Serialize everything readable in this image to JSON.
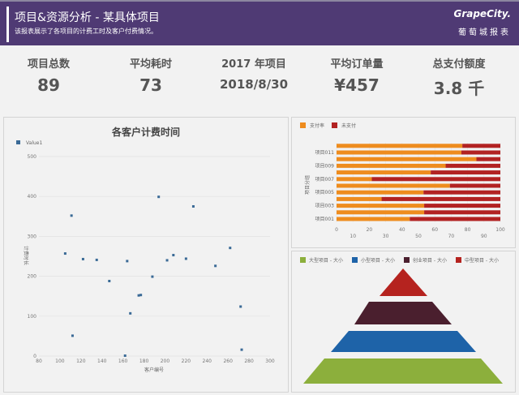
{
  "header": {
    "title": "项目&资源分析 - 某具体项目",
    "subtitle": "该报表展示了各项目的计费工时及客户付费情况。",
    "logo": "GrapeCity.",
    "logo_sub": "葡萄城报表"
  },
  "kpis": [
    {
      "label": "项目总数",
      "value": "89"
    },
    {
      "label": "平均耗时",
      "value": "73"
    },
    {
      "label": "2017 年项目",
      "value": "2018/8/30"
    },
    {
      "label": "平均订单量",
      "value": "¥457"
    },
    {
      "label": "总支付额度",
      "value": "3.8 千"
    }
  ],
  "colors": {
    "header": "#4f3a74",
    "scatter": "#3a6a96",
    "paid": "#ee8c1e",
    "unpaid": "#b22222"
  },
  "chart_data": [
    {
      "type": "scatter",
      "title": "各客户计费时间",
      "xlabel": "客户编号",
      "ylabel": "计费时长",
      "legend": [
        "Value1"
      ],
      "legend_position": "top-left",
      "xlim": [
        80,
        300
      ],
      "ylim": [
        0,
        500
      ],
      "xticks": [
        "80",
        "100",
        "120",
        "140",
        "160",
        "180",
        "200",
        "220",
        "240",
        "260",
        "280",
        "300"
      ],
      "yticks": [
        "0",
        "100",
        "200",
        "300",
        "400",
        "500"
      ],
      "grid": true,
      "series": [
        {
          "name": "Value1",
          "points": [
            [
              105,
              257
            ],
            [
              111,
              352
            ],
            [
              112,
              51
            ],
            [
              122,
              243
            ],
            [
              135,
              241
            ],
            [
              147,
              188
            ],
            [
              162,
              1
            ],
            [
              164,
              238
            ],
            [
              167,
              107
            ],
            [
              175,
              152
            ],
            [
              177,
              153
            ],
            [
              188,
              199
            ],
            [
              194,
              399
            ],
            [
              202,
              240
            ],
            [
              208,
              253
            ],
            [
              220,
              244
            ],
            [
              227,
              375
            ],
            [
              248,
              226
            ],
            [
              262,
              271
            ],
            [
              272,
              124
            ],
            [
              273,
              16
            ]
          ]
        }
      ]
    },
    {
      "type": "bar",
      "orientation": "horizontal",
      "stacked": true,
      "ylabel": "项目分组",
      "legend": [
        "支付率",
        "未支付"
      ],
      "legend_position": "top-left",
      "xlim": [
        0,
        100
      ],
      "xticks": [
        "0",
        "10",
        "20",
        "30",
        "40",
        "50",
        "60",
        "70",
        "80",
        "90",
        "100"
      ],
      "categories": [
        "项目001",
        "项目002",
        "项目003",
        "项目004",
        "项目005",
        "项目006",
        "项目007",
        "项目008",
        "项目009",
        "项目010",
        "项目011",
        "项目012"
      ],
      "category_labels_shown": [
        "项目001",
        "项目003",
        "项目005",
        "项目007",
        "项目009",
        "项目011"
      ],
      "series": [
        {
          "name": "支付率",
          "values": [
            44.7,
            53.5,
            53.5,
            27.5,
            53.1,
            69.2,
            21.5,
            57.5,
            66.6,
            85.4,
            76.2,
            76.8
          ]
        },
        {
          "name": "未支付",
          "values": [
            55.3,
            46.5,
            46.5,
            72.5,
            46.9,
            30.8,
            78.5,
            42.5,
            33.4,
            14.6,
            23.8,
            23.2
          ]
        }
      ]
    },
    {
      "type": "pyramid",
      "legend": [
        "大型项目 - 大小",
        "小型项目 - 大小",
        "创业项目 - 大小",
        "中型项目 - 大小"
      ],
      "legend_position": "top",
      "levels": [
        {
          "name": "中型项目 - 大小",
          "color": "#b5231f"
        },
        {
          "name": "创业项目 - 大小",
          "color": "#4a1f2e"
        },
        {
          "name": "小型项目 - 大小",
          "color": "#1e63a8"
        },
        {
          "name": "大型项目 - 大小",
          "color": "#8caf3c"
        }
      ]
    }
  ]
}
